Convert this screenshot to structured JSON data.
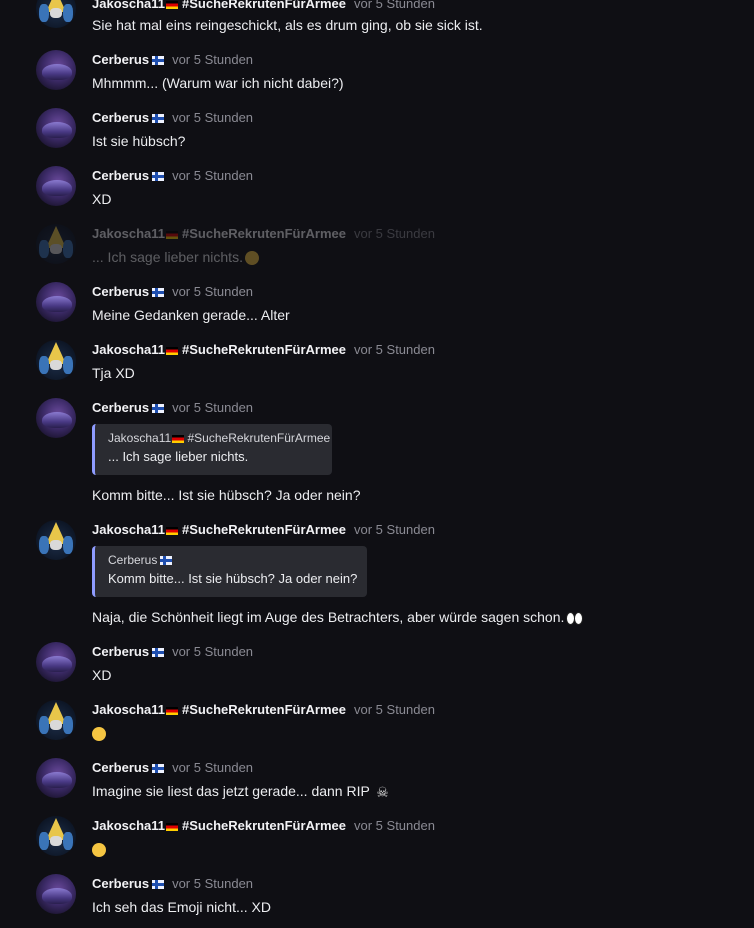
{
  "users": {
    "cerberus": "Cerberus",
    "jakoscha": "Jakoscha11",
    "jakoscha_tag": "#SucheRekrutenFürArmee"
  },
  "messages": [
    {
      "author": "jakoscha",
      "time": "vor 5 Stunden",
      "text": "Sie hat mal eins reingeschickt, als es drum ging, ob sie sick ist."
    },
    {
      "author": "cerberus",
      "time": "vor 5 Stunden",
      "text": "Mhmmm... (Warum war ich nicht dabei?)"
    },
    {
      "author": "cerberus",
      "time": "vor 5 Stunden",
      "text": "Ist sie hübsch?"
    },
    {
      "author": "cerberus",
      "time": "vor 5 Stunden",
      "text": "XD"
    },
    {
      "author": "jakoscha",
      "time": "vor 5 Stunden",
      "text": "... Ich sage lieber nichts.",
      "emoji": "grin",
      "faded": true
    },
    {
      "author": "cerberus",
      "time": "vor 5 Stunden",
      "text": "Meine Gedanken gerade... Alter"
    },
    {
      "author": "jakoscha",
      "time": "vor 5 Stunden",
      "text": "Tja XD"
    },
    {
      "author": "cerberus",
      "time": "vor 5 Stunden",
      "quote": {
        "author": "Jakoscha11",
        "tag": "#SucheRekrutenFürArmee",
        "text": "... Ich sage lieber nichts."
      },
      "text": "Komm bitte... Ist sie hübsch? Ja oder nein?"
    },
    {
      "author": "jakoscha",
      "time": "vor 5 Stunden",
      "quote": {
        "author": "Cerberus",
        "text": "Komm bitte... Ist sie hübsch? Ja oder nein?"
      },
      "text": "Naja, die Schönheit liegt im Auge des Betrachters, aber würde sagen schon.",
      "emoji": "eyes"
    },
    {
      "author": "cerberus",
      "time": "vor 5 Stunden",
      "text": "XD"
    },
    {
      "author": "jakoscha",
      "time": "vor 5 Stunden",
      "text": "",
      "emoji": "grinning-squint"
    },
    {
      "author": "cerberus",
      "time": "vor 5 Stunden",
      "text": "Imagine sie liest das jetzt gerade... dann RIP",
      "emoji": "skull-crossbones"
    },
    {
      "author": "jakoscha",
      "time": "vor 5 Stunden",
      "text": "",
      "emoji": "tear-smile"
    },
    {
      "author": "cerberus",
      "time": "vor 5 Stunden",
      "text": "Ich seh das Emoji nicht... XD"
    }
  ]
}
